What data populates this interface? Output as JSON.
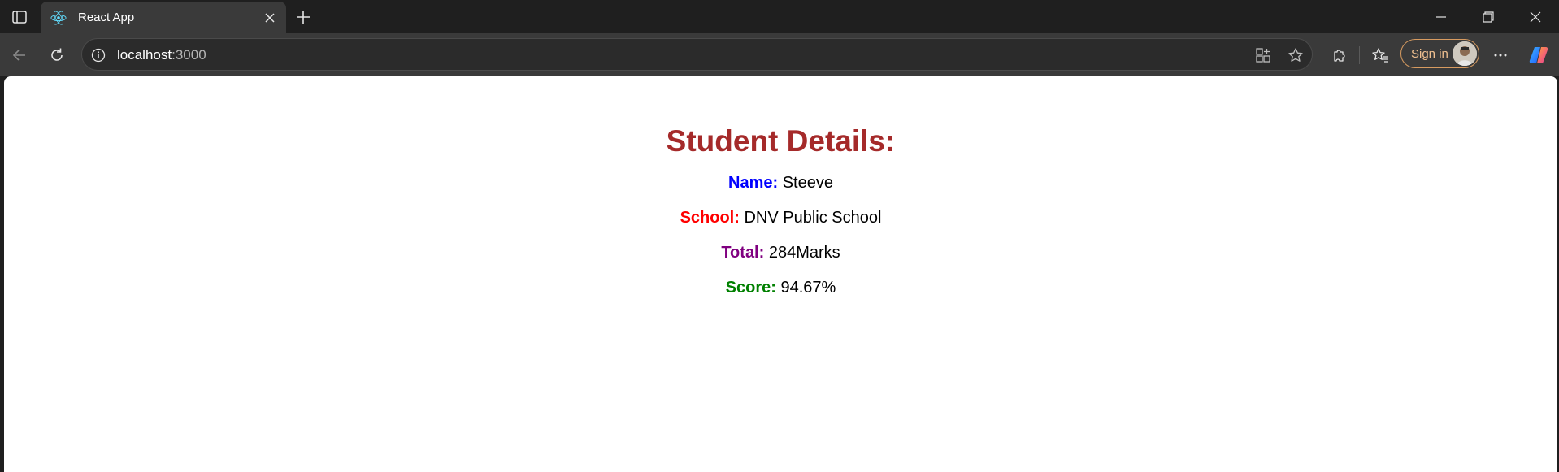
{
  "browser": {
    "tab": {
      "title": "React App"
    },
    "address": {
      "host": "localhost",
      "port": ":3000"
    },
    "signin_label": "Sign in",
    "icons": {
      "tab_actions": "tab-actions-icon",
      "favicon": "react-logo-icon",
      "close": "close-icon",
      "new_tab": "plus-icon",
      "minimize": "minimize-icon",
      "restore": "restore-icon",
      "window_close": "close-icon",
      "back": "back-arrow-icon",
      "refresh": "refresh-icon",
      "info": "info-icon",
      "app_available": "apps-icon",
      "favorite": "star-icon",
      "extensions": "puzzle-icon",
      "favorites": "favorites-icon",
      "more": "more-icon",
      "copilot": "copilot-icon"
    }
  },
  "page": {
    "heading": "Student Details:",
    "rows": [
      {
        "key": "Name:",
        "value": "Steeve",
        "color": "#0000ff"
      },
      {
        "key": "School:",
        "value": "DNV Public School",
        "color": "#ff0000"
      },
      {
        "key": "Total:",
        "value": "284Marks",
        "color": "#800080"
      },
      {
        "key": "Score:",
        "value": "94.67%",
        "color": "#008000"
      }
    ],
    "heading_color": "#a52a2a"
  }
}
